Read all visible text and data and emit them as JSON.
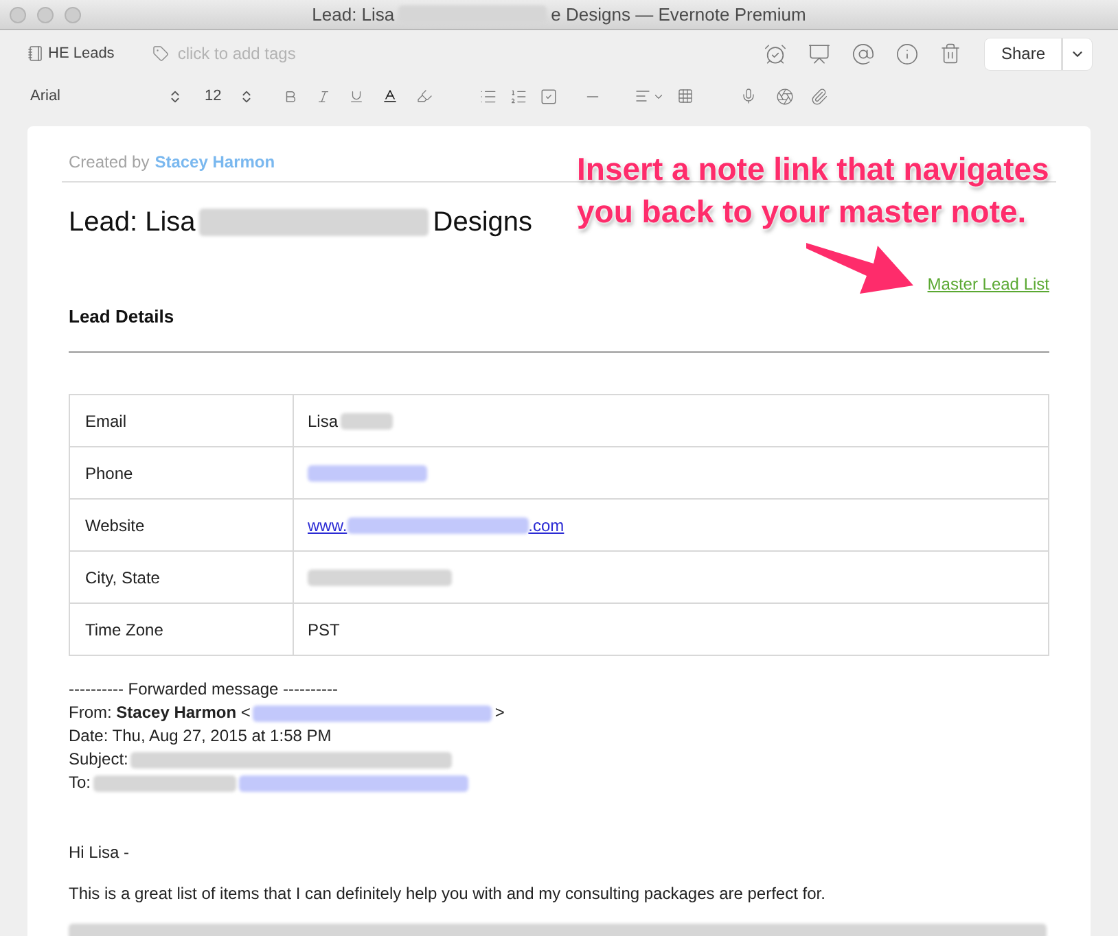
{
  "window": {
    "title": [
      {
        "kind": "text",
        "text": "Lead: Lisa"
      },
      {
        "kind": "redacted"
      },
      {
        "kind": "text",
        "text": "e Designs — Evernote Premium"
      }
    ]
  },
  "toolbar": {
    "notebook": "HE Leads",
    "tags": {
      "placeholder": "click to add tags"
    },
    "share": "Share",
    "font": "Arial",
    "size": "12"
  },
  "note": {
    "created_by": "Created by",
    "author": "Stacey Harmon",
    "title": [
      {
        "kind": "text",
        "text": "Lead: Lisa"
      },
      {
        "kind": "redacted"
      },
      {
        "kind": "text",
        "text": "Designs"
      }
    ],
    "note_link": "Master Lead List",
    "heading": "Lead Details",
    "details": [
      {
        "label": "Email",
        "value": [
          {
            "kind": "text",
            "text": "Lisa"
          },
          {
            "kind": "redacted"
          }
        ]
      },
      {
        "label": "Phone",
        "value": [
          {
            "kind": "redacted_link"
          }
        ]
      },
      {
        "label": "Website",
        "value": [
          {
            "kind": "link",
            "text": "www."
          },
          {
            "kind": "redacted_link"
          },
          {
            "kind": "link",
            "text": ".com"
          }
        ]
      },
      {
        "label": "City, State",
        "value": [
          {
            "kind": "redacted"
          }
        ]
      },
      {
        "label": "Time Zone",
        "value": [
          {
            "kind": "text",
            "text": "PST"
          }
        ]
      }
    ],
    "forwarded": {
      "heading": "---------- Forwarded message ----------",
      "lines": [
        [
          {
            "kind": "text",
            "text": "From: **Stacey Harmon** <"
          },
          {
            "kind": "redacted_link"
          },
          {
            "kind": "text",
            "text": ">"
          }
        ],
        [
          {
            "kind": "text",
            "text": "Date: Thu, Aug 27, 2015 at 1:58 PM"
          }
        ],
        [
          {
            "kind": "text",
            "text": "Subject:"
          },
          {
            "kind": "redacted"
          }
        ],
        [
          {
            "kind": "text",
            "text": "To:"
          },
          {
            "kind": "redacted"
          },
          {
            "kind": "redacted_link"
          }
        ]
      ]
    },
    "body": [
      [
        {
          "kind": "text",
          "text": "Hi Lisa -"
        }
      ],
      [
        {
          "kind": "text",
          "text": "This is a great list of items that I can definitely help you with and my consulting packages are perfect for."
        }
      ],
      [
        {
          "kind": "redacted"
        }
      ]
    ]
  },
  "annotation": {
    "lines": [
      "Insert a note link that navigates",
      "you back to your master note."
    ]
  }
}
